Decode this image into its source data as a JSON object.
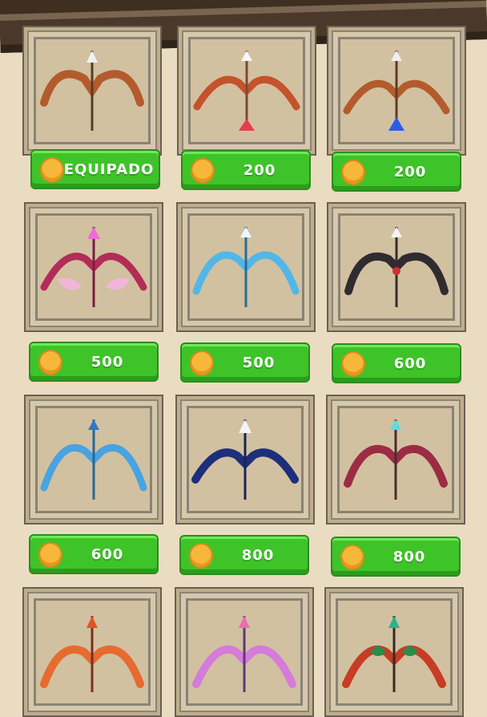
{
  "shop": {
    "items": [
      {
        "price_label": "EQUIPADO",
        "bow_icon": "copper-bow-icon"
      },
      {
        "price_label": "200",
        "bow_icon": "red-feather-bow-icon"
      },
      {
        "price_label": "200",
        "bow_icon": "blue-feather-bow-icon"
      },
      {
        "price_label": "500",
        "bow_icon": "pink-wing-bow-icon"
      },
      {
        "price_label": "500",
        "bow_icon": "ice-crystal-bow-icon"
      },
      {
        "price_label": "600",
        "bow_icon": "dark-demon-bow-icon"
      },
      {
        "price_label": "600",
        "bow_icon": "frost-branch-bow-icon"
      },
      {
        "price_label": "800",
        "bow_icon": "sapphire-bat-bow-icon"
      },
      {
        "price_label": "800",
        "bow_icon": "crimson-horn-bow-icon"
      },
      {
        "price_label": "",
        "bow_icon": "flame-bow-icon"
      },
      {
        "price_label": "",
        "bow_icon": "pastel-spirit-bow-icon"
      },
      {
        "price_label": "",
        "bow_icon": "leaf-vine-bow-icon"
      }
    ]
  },
  "colors": {
    "background": "#e9dcc0",
    "button_green": "#3ec429",
    "coin": "#f6b73a",
    "top_bar": "#4c3a29"
  }
}
